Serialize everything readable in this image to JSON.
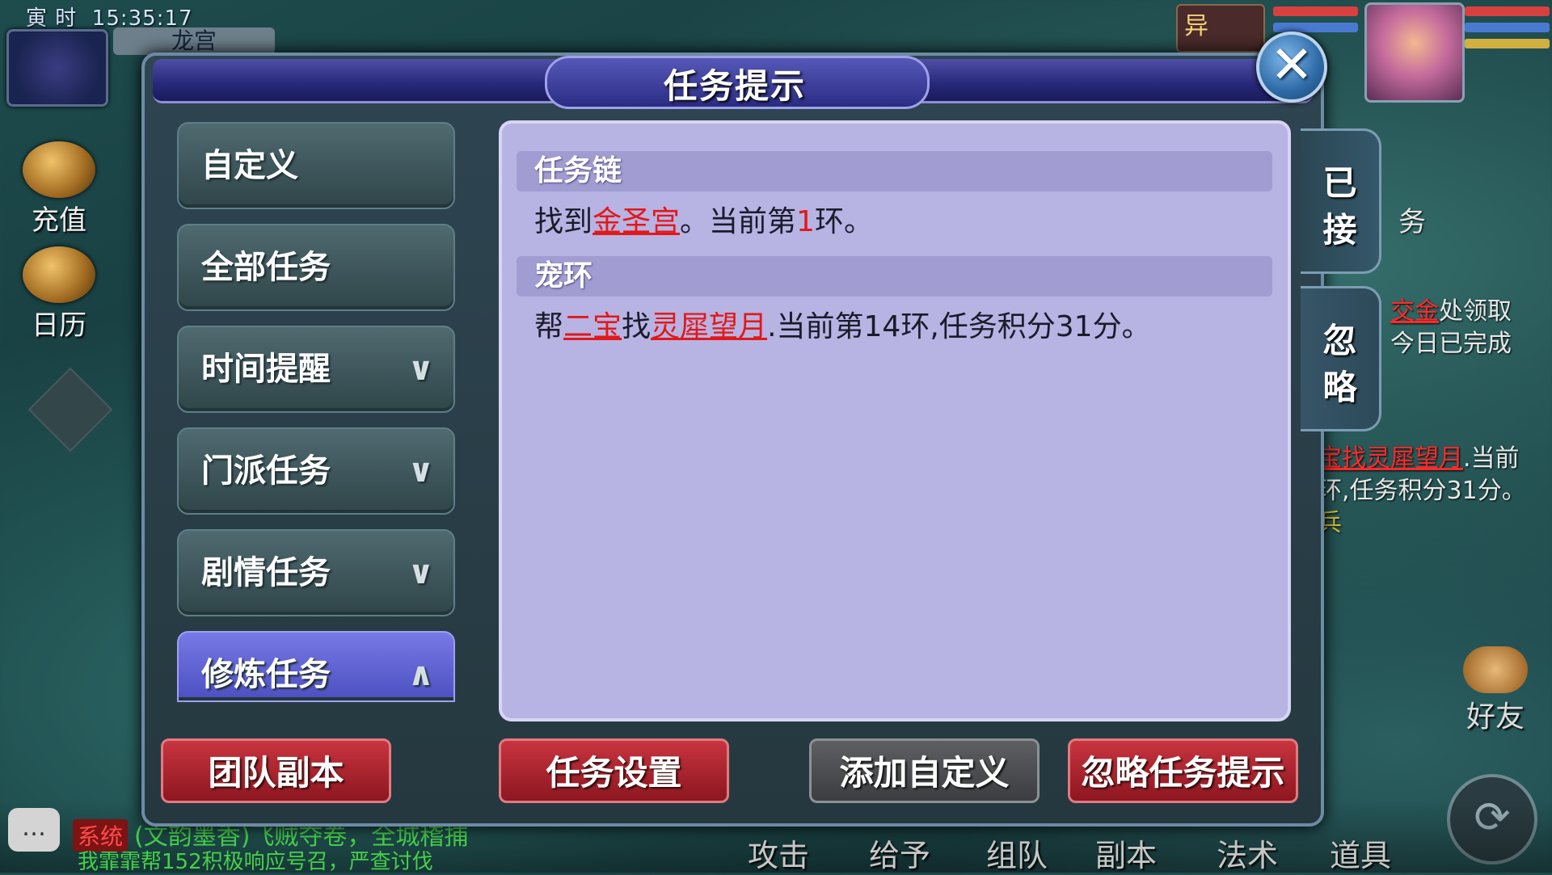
{
  "hud": {
    "time_label": "寅 时",
    "clock": "15:35:17",
    "place": "龙宫",
    "side_buttons": [
      "充值",
      "日历"
    ]
  },
  "right_panel": {
    "task_text_1a": "交金",
    "task_text_1b": "处领取",
    "task_text_2": "今日已完成",
    "task_text_3a": "宝找",
    "task_text_3b": "灵犀望月",
    "task_text_3c": ".当前",
    "task_text_4": "环,任务积分31分。",
    "task_text_5": "兵",
    "badge": "异",
    "friend_label": "好友",
    "side_char": "务"
  },
  "bottom_bar": {
    "items": [
      "攻击",
      "给予",
      "组队",
      "副本",
      "法术",
      "道具"
    ],
    "chat_tag": "系统",
    "chat_line1": "(文韵墨香)飞贼夺卷，全城稽捕",
    "chat_line2": "我霏霏帮152积极响应号召，严查讨伐"
  },
  "dialog": {
    "title": "任务提示",
    "close_glyph": "✕",
    "categories": [
      {
        "label": "自定义",
        "chevron": ""
      },
      {
        "label": "全部任务",
        "chevron": ""
      },
      {
        "label": "时间提醒",
        "chevron": "∨"
      },
      {
        "label": "门派任务",
        "chevron": "∨"
      },
      {
        "label": "剧情任务",
        "chevron": "∨"
      },
      {
        "label": "修炼任务",
        "chevron": "∧"
      }
    ],
    "sections": [
      {
        "title": "任务链",
        "prefix": "找到",
        "link": "金圣宫",
        "middle": "。当前第",
        "num": "1",
        "suffix": "环。"
      },
      {
        "title": "宠环",
        "prefix": "帮",
        "link1": "二宝",
        "middle1": "找",
        "link2": "灵犀望月",
        "suffix": ".当前第14环,任务积分31分。"
      }
    ],
    "side_tabs": [
      "已接",
      "忽略"
    ],
    "actions": [
      "团队副本",
      "任务设置",
      "添加自定义",
      "忽略任务提示"
    ]
  }
}
